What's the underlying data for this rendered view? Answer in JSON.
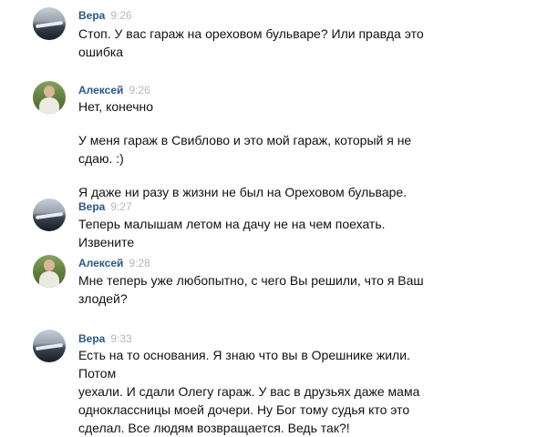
{
  "messages": [
    {
      "author": "Вера",
      "time": "9:26",
      "paragraphs": [
        [
          "Стоп. У вас гараж на ореховом бульваре? Или правда это",
          "ошибка"
        ]
      ]
    },
    {
      "author": "Алексей",
      "time": "9:26",
      "paragraphs": [
        [
          "Нет, конечно"
        ],
        [
          "У меня гараж в Свиблово и это мой гараж, который я не сдаю. :)"
        ],
        [
          "Я даже ни разу в жизни не был на Ореховом бульваре."
        ]
      ]
    },
    {
      "author": "Вера",
      "time": "9:27",
      "paragraphs": [
        [
          "Теперь малышам летом на дачу не на чем поехать. Извените"
        ]
      ]
    },
    {
      "author": "Алексей",
      "time": "9:28",
      "paragraphs": [
        [
          "Мне теперь уже любопытно, с чего Вы решили, что я Ваш",
          "злодей?"
        ]
      ]
    },
    {
      "author": "Вера",
      "time": "9:33",
      "paragraphs": [
        [
          "Есть на то основания. Я знаю что вы в Орешнике жили. Потом",
          "уехали. И сдали Олегу гараж. У вас в друзьях даже мама",
          "одноклассницы моей дочери. Ну Бог тому судья кто это",
          "сделал. Все людям возвращается. Ведь так?!"
        ]
      ]
    }
  ],
  "colors": {
    "author": "#2a5885",
    "time": "#b4b8bd",
    "text": "#111111"
  }
}
